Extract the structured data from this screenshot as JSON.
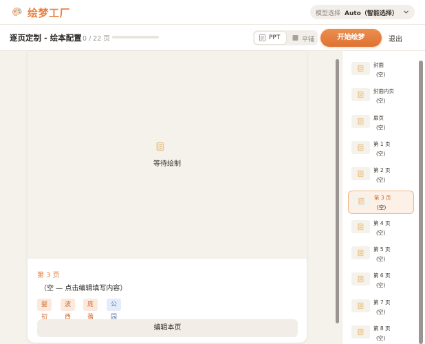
{
  "app": {
    "title": "绘梦工厂"
  },
  "model": {
    "label": "模型选择",
    "value": "Auto（智能选择）"
  },
  "header": {
    "title": "逐页定制 - 绘本配置",
    "progress_text": "0 / 22 页",
    "progress_fraction": 0,
    "view_ppt": "PPT",
    "view_flat": "平铺",
    "start_label": "开始绘梦",
    "exit_label": "退出"
  },
  "card": {
    "waiting_text": "等待绘制",
    "page_label": "第 3 页",
    "content_placeholder": "（空 — 点击编辑填写内容）",
    "tags": [
      "婴初",
      "波西",
      "庞蓓",
      "公园"
    ],
    "edit_label": "编辑本页"
  },
  "sidebar": {
    "items": [
      {
        "title": "封面",
        "sub": "(空)"
      },
      {
        "title": "封面内页",
        "sub": "(空)"
      },
      {
        "title": "扉页",
        "sub": "(空)"
      },
      {
        "title": "第 1 页",
        "sub": "(空)"
      },
      {
        "title": "第 2 页",
        "sub": "(空)"
      },
      {
        "title": "第 3 页",
        "sub": "(空)"
      },
      {
        "title": "第 4 页",
        "sub": "(空)"
      },
      {
        "title": "第 5 页",
        "sub": "(空)"
      },
      {
        "title": "第 6 页",
        "sub": "(空)"
      },
      {
        "title": "第 7 页",
        "sub": "(空)"
      },
      {
        "title": "第 8 页",
        "sub": "(空)"
      }
    ],
    "active_index": 5
  },
  "colors": {
    "accent": "#e8803f",
    "canvas": "#f5f1eb"
  },
  "icons": {
    "logo": "palette-icon",
    "page": "scroll-icon",
    "chevron": "chevron-down-icon"
  }
}
